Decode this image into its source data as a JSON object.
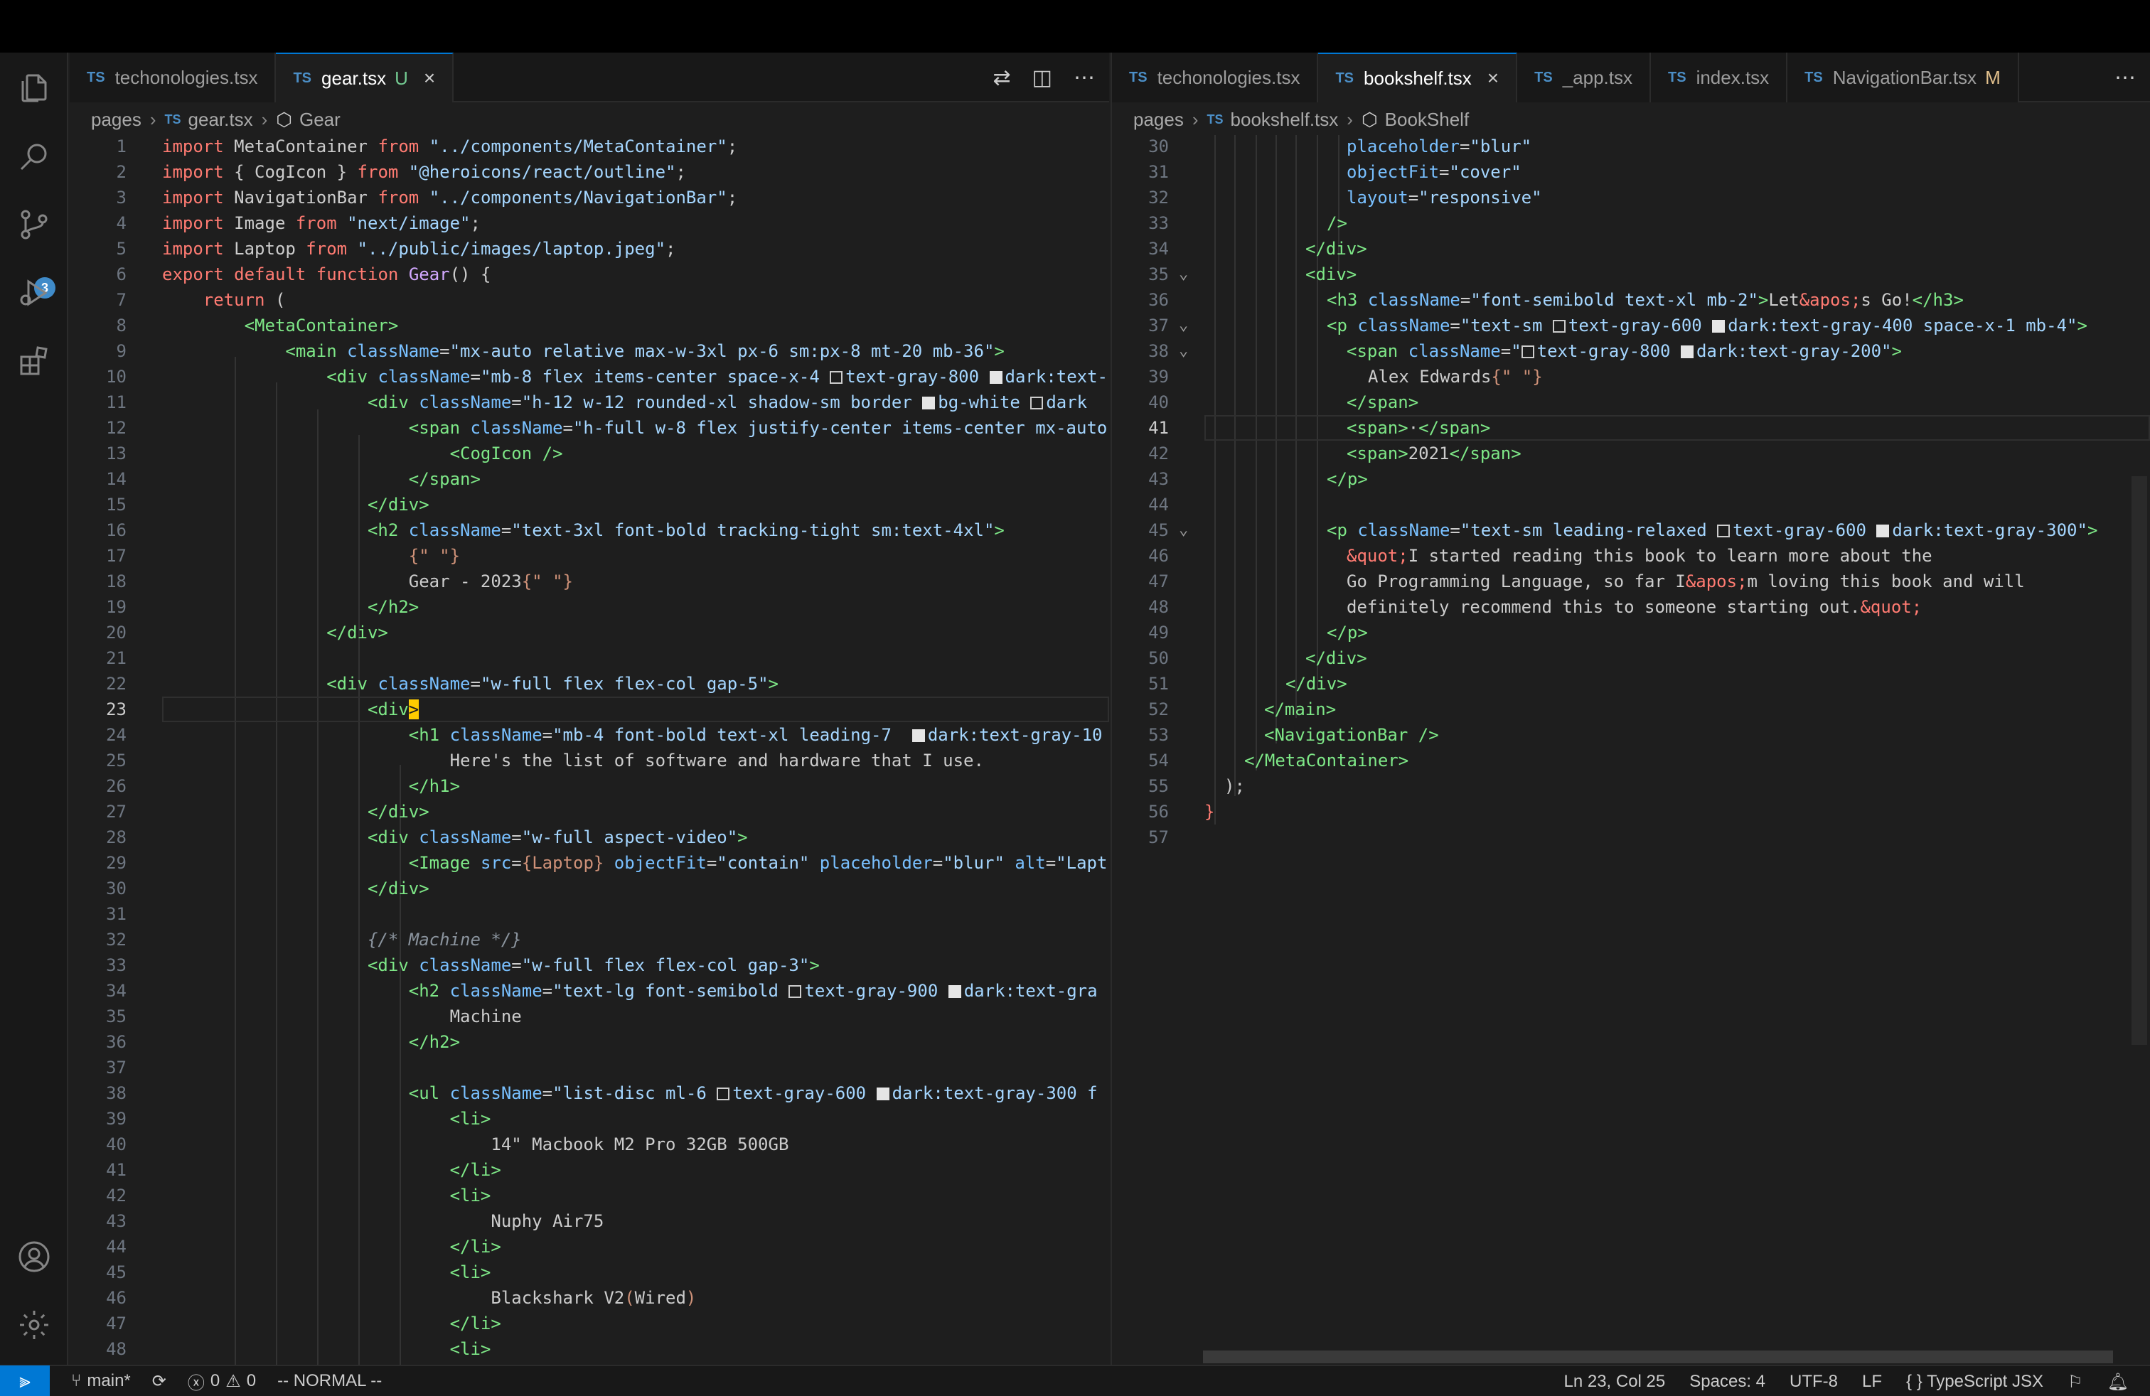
{
  "left_editor": {
    "tabs": [
      {
        "label": "techonologies.tsx",
        "active": false,
        "status": ""
      },
      {
        "label": "gear.tsx",
        "active": true,
        "status": "U"
      }
    ],
    "breadcrumb": [
      "pages",
      "gear.tsx",
      "Gear"
    ],
    "lines": [
      "1",
      "2",
      "3",
      "4",
      "5",
      "6",
      "7",
      "8",
      "9",
      "10",
      "11",
      "12",
      "13",
      "14",
      "15",
      "16",
      "17",
      "18",
      "19",
      "20",
      "21",
      "22",
      "23",
      "24",
      "25",
      "26",
      "27",
      "28",
      "29",
      "30",
      "31",
      "32",
      "33",
      "34",
      "35",
      "36",
      "37",
      "38",
      "39",
      "40",
      "41",
      "42",
      "43",
      "44",
      "45",
      "46",
      "47",
      "48"
    ]
  },
  "right_editor": {
    "tabs": [
      {
        "label": "techonologies.tsx",
        "active": false,
        "status": ""
      },
      {
        "label": "bookshelf.tsx",
        "active": true,
        "status": ""
      },
      {
        "label": "_app.tsx",
        "active": false,
        "status": ""
      },
      {
        "label": "index.tsx",
        "active": false,
        "status": ""
      },
      {
        "label": "NavigationBar.tsx",
        "active": false,
        "status": "M"
      }
    ],
    "breadcrumb": [
      "pages",
      "bookshelf.tsx",
      "BookShelf"
    ],
    "lines": [
      "30",
      "31",
      "32",
      "33",
      "34",
      "35",
      "36",
      "37",
      "38",
      "39",
      "40",
      "41",
      "42",
      "43",
      "44",
      "45",
      "46",
      "47",
      "48",
      "49",
      "50",
      "51",
      "52",
      "53",
      "54",
      "55",
      "56",
      "57"
    ]
  },
  "ts_label": "TS",
  "source_control_badge": "3",
  "status": {
    "branch": "main*",
    "errors": "0",
    "warnings": "0",
    "mode": "-- NORMAL --",
    "position": "Ln 23, Col 25",
    "spaces": "Spaces: 4",
    "encoding": "UTF-8",
    "eol": "LF",
    "language": "TypeScript JSX"
  },
  "colors": {
    "accent": "#0078d4",
    "keyword": "#ff7b72",
    "string": "#a5d6ff",
    "tag": "#7ee787",
    "attribute": "#79c0ff",
    "function": "#d2a8ff"
  }
}
